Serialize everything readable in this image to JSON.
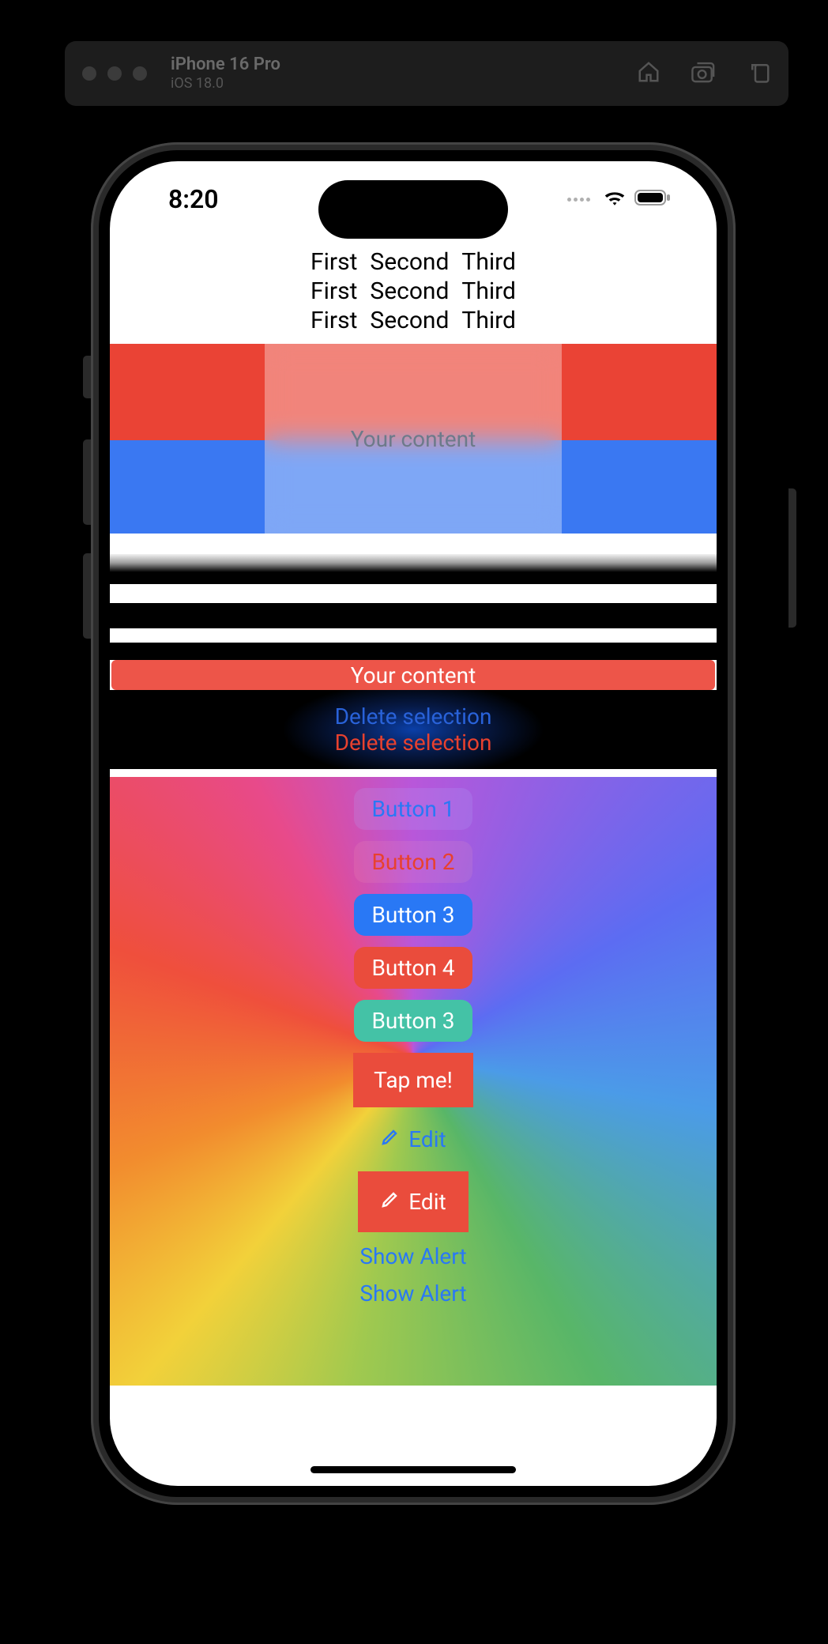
{
  "simulator": {
    "device": "iPhone 16 Pro",
    "os": "iOS 18.0"
  },
  "status": {
    "time": "8:20"
  },
  "text_rows": {
    "first": "First",
    "second": "Second",
    "third": "Third"
  },
  "frosted_label": "Your content",
  "red_bar_label": "Your content",
  "delete_blue": "Delete selection",
  "delete_red": "Delete selection",
  "buttons": {
    "b1": "Button 1",
    "b2": "Button 2",
    "b3": "Button 3",
    "b4": "Button 4",
    "b3b": "Button 3",
    "tap": "Tap me!",
    "edit1": "Edit",
    "edit2": "Edit",
    "alert1": "Show Alert",
    "alert2": "Show Alert"
  }
}
